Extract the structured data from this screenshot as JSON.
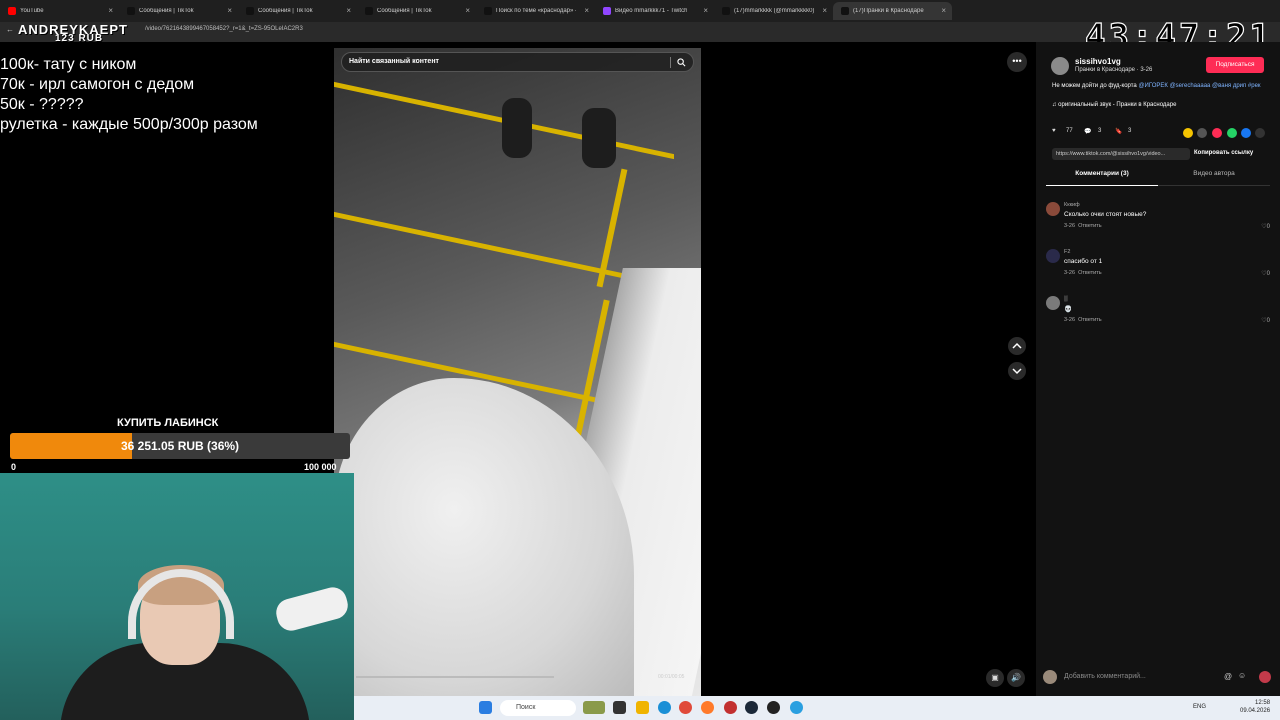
{
  "browser": {
    "tabs": [
      {
        "label": "YouTube",
        "color": "#ff0000"
      },
      {
        "label": "Сообщения | TikTok",
        "color": "#111111"
      },
      {
        "label": "Сообщения | TikTok",
        "color": "#111111"
      },
      {
        "label": "Сообщения | TikTok",
        "color": "#111111"
      },
      {
        "label": "Поиск по теме «краснодар» -",
        "color": "#111111"
      },
      {
        "label": "Видео mmarkkk71 - Twitch",
        "color": "#9146ff"
      },
      {
        "label": "(17)mmarkkkk (@mmarkkkk0) |",
        "color": "#111111"
      },
      {
        "label": "(17)Пранки в Краснодаре",
        "color": "#111111"
      }
    ],
    "url": "/video/7621643899467058452?_r=1&_t=ZS-95OLeIAC2R3"
  },
  "stream": {
    "streamer_name": "ANDREYKAEPT",
    "overlay_rub": "123 RUB",
    "timer": "43:47:21",
    "donation_lines": [
      "100к- тату с ником",
      "70к - ирл самогон с дедом",
      "50к - ?????",
      "рулетка - каждые 500р/300р разом"
    ],
    "goal": {
      "title": "КУПИТЬ ЛАБИНСК",
      "progress_text": "36 251.05 RUB (36%)",
      "progress_fraction": 0.36,
      "min_label": "0",
      "max_label": "100 000",
      "fill_color": "#f0890c"
    }
  },
  "viewer": {
    "search_placeholder": "Найти связанный контент",
    "more_glyph": "•••",
    "timecode": "00:01/00:05",
    "video_progress": 0.54
  },
  "panel": {
    "author": "sissihvo1vg",
    "subtitle": "Пранки в Краснодаре · 3-26",
    "follow_label": "Подписаться",
    "caption_text": "Не можем дойти до фуд-корта ",
    "caption_tags": "@ИГОРЕК @serechaaaaa @ваня дрип #рек",
    "sound": "♫ оригинальный звук - Пранки в Краснодаре",
    "likes": "77",
    "comments_count": "3",
    "saves": "3",
    "link": "https://www.tiktok.com/@sissihvo1vg/video...",
    "copy_link_label": "Копировать ссылку",
    "tab_comments": "Комментарии (3)",
    "tab_creator": "Видео автора",
    "comments": [
      {
        "name": "Кккиф",
        "text": "Сколько очки стоят новые?",
        "date": "3-26",
        "reply": "Ответить",
        "likes": "0"
      },
      {
        "name": "F2",
        "text": "спасибо от 1",
        "date": "3-26",
        "reply": "Ответить",
        "likes": "0"
      },
      {
        "name": "▒",
        "text": "💀",
        "date": "3-26",
        "reply": "Ответить",
        "likes": "0"
      }
    ],
    "comment_placeholder": "Добавить комментарий..."
  },
  "taskbar": {
    "search_label": "Поиск",
    "lang": "ENG",
    "time": "12:58",
    "date": "09.04.2026"
  }
}
